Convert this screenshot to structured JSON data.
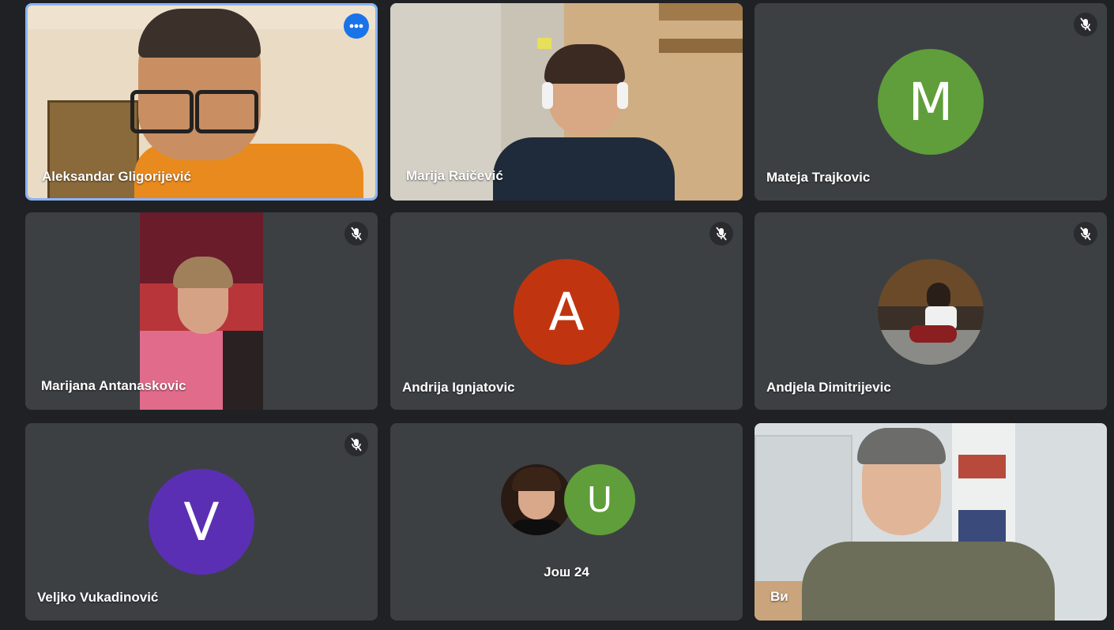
{
  "tiles": [
    {
      "name": "Aleksandar Gligorijević"
    },
    {
      "name": "Marija Raičević"
    },
    {
      "name": "Mateja Trajkovic",
      "initial": "M",
      "color": "#5f9e3a"
    },
    {
      "name": "Marijana Antanaskovic"
    },
    {
      "name": "Andrija Ignjatovic",
      "initial": "A",
      "color": "#c0350f"
    },
    {
      "name": "Andjela Dimitrijevic"
    },
    {
      "name": "Veljko Vukadinović",
      "initial": "V",
      "color": "#5b2fb3"
    },
    {
      "more_label": "Још 24",
      "initial": "U",
      "color": "#5f9e3a"
    },
    {
      "name": "Ви"
    }
  ],
  "colors": {
    "active_border": "#8ab4f8",
    "more_button": "#1a73e8",
    "tile_bg": "#3c4043",
    "page_bg": "#202124"
  }
}
